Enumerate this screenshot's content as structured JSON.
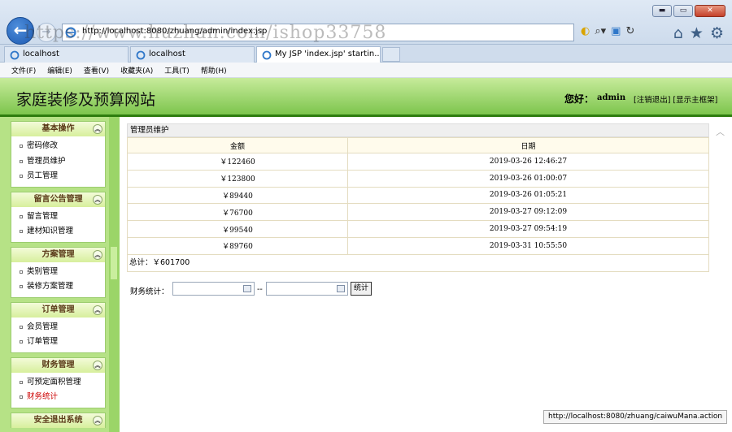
{
  "browser": {
    "address_url": "http://localhost:8080/zhuang/admin/index.jsp",
    "watermark": "https://www.huzhan.com/ishop33758",
    "tabs": [
      {
        "label": "localhost"
      },
      {
        "label": "localhost"
      },
      {
        "label": "My JSP 'index.jsp' startin..."
      }
    ],
    "menu": [
      "文件(F)",
      "编辑(E)",
      "查看(V)",
      "收藏夹(A)",
      "工具(T)",
      "帮助(H)"
    ],
    "status_url": "http://localhost:8080/zhuang/caiwuMana.action"
  },
  "header": {
    "title": "家庭装修及预算网站",
    "greeting": "您好：",
    "username": "admin",
    "links": "[注销退出] [显示主框架]"
  },
  "sidebar": {
    "groups": [
      {
        "title": "基本操作",
        "items": [
          "密码修改",
          "管理员维护",
          "员工管理"
        ]
      },
      {
        "title": "留言公告管理",
        "items": [
          "留言管理",
          "建材知识管理"
        ]
      },
      {
        "title": "方案管理",
        "items": [
          "类别管理",
          "装修方案管理"
        ]
      },
      {
        "title": "订单管理",
        "items": [
          "会员管理",
          "订单管理"
        ]
      },
      {
        "title": "财务管理",
        "items": [
          "可预定面积管理",
          "财务统计"
        ]
      },
      {
        "title": "安全退出系统",
        "items": []
      }
    ]
  },
  "main": {
    "panel_title": "管理员维护",
    "columns": [
      "金额",
      "日期"
    ],
    "rows": [
      {
        "amount": "￥122460",
        "date": "2019-03-26 12:46:27"
      },
      {
        "amount": "￥123800",
        "date": "2019-03-26 01:00:07"
      },
      {
        "amount": "￥89440",
        "date": "2019-03-26 01:05:21"
      },
      {
        "amount": "￥76700",
        "date": "2019-03-27 09:12:09"
      },
      {
        "amount": "￥99540",
        "date": "2019-03-27 09:54:19"
      },
      {
        "amount": "￥89760",
        "date": "2019-03-31 10:55:50"
      }
    ],
    "total": "总计：￥601700",
    "filter": {
      "label": "财务统计：",
      "separator": "--",
      "button": "统计"
    }
  }
}
